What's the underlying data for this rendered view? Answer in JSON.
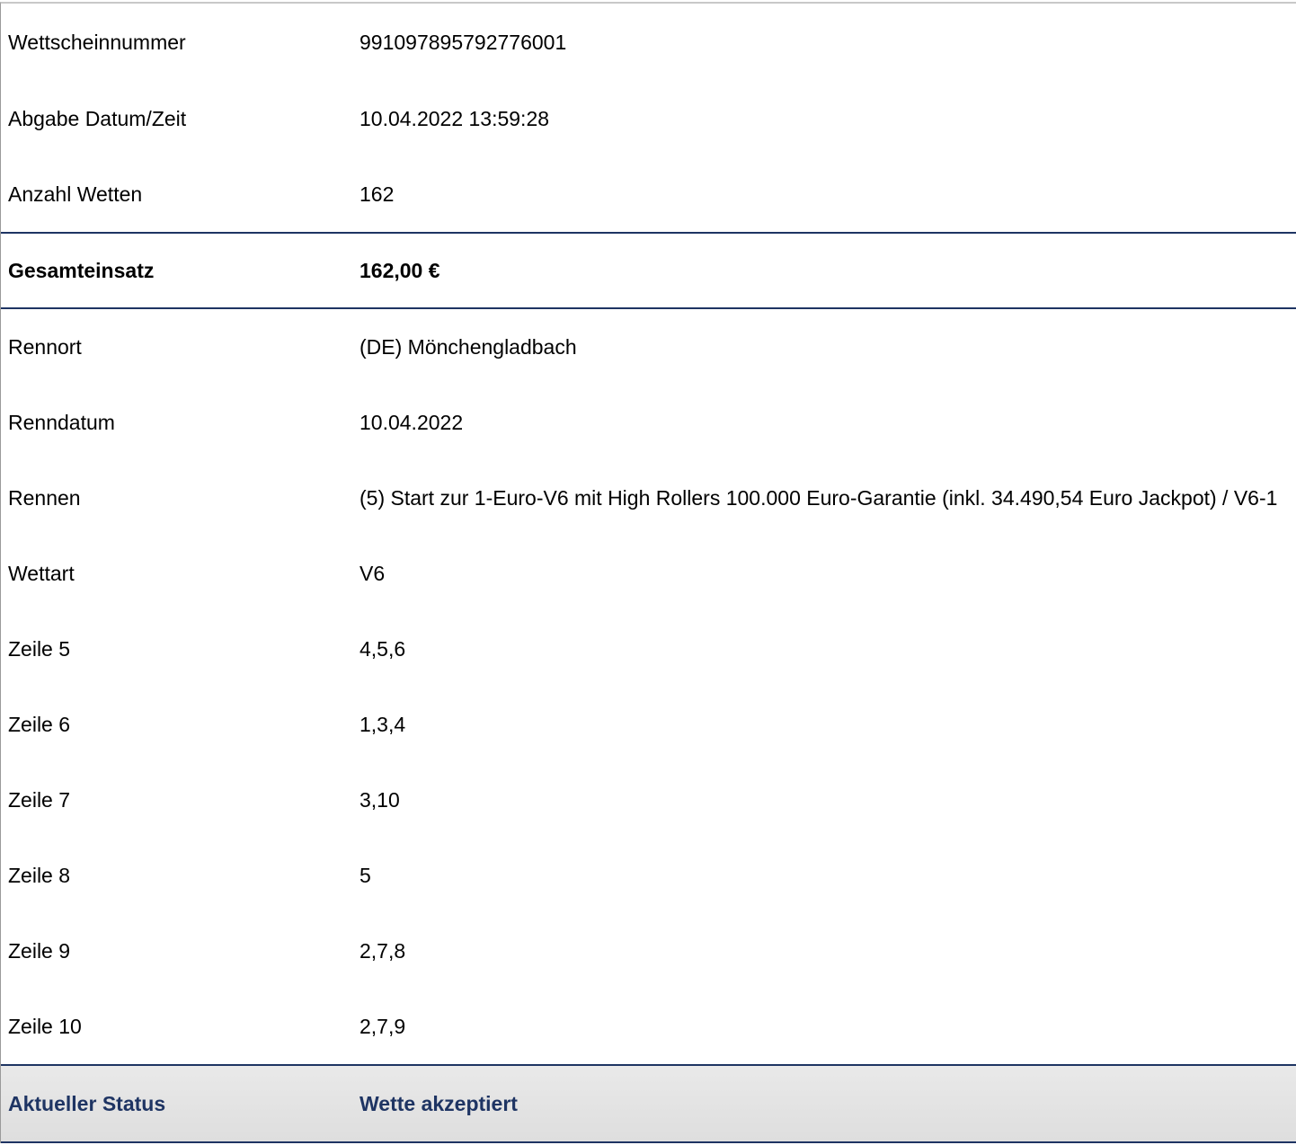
{
  "ticket": {
    "number": {
      "label": "Wettscheinnummer",
      "value": "991097895792776001"
    },
    "submitted": {
      "label": "Abgabe Datum/Zeit",
      "value": "10.04.2022 13:59:28"
    },
    "bet_count": {
      "label": "Anzahl Wetten",
      "value": "162"
    },
    "total_stake": {
      "label": "Gesamteinsatz",
      "value": "162,00 €"
    },
    "race_venue": {
      "label": "Rennort",
      "value": "(DE) Mönchengladbach"
    },
    "race_date": {
      "label": "Renndatum",
      "value": "10.04.2022"
    },
    "race": {
      "label": "Rennen",
      "value": "(5) Start zur 1-Euro-V6 mit High Rollers 100.000 Euro-Garantie (inkl. 34.490,54 Euro Jackpot) / V6-1"
    },
    "bet_type": {
      "label": "Wettart",
      "value": "V6"
    },
    "lines": [
      {
        "label": "Zeile 5",
        "value": "4,5,6"
      },
      {
        "label": "Zeile 6",
        "value": "1,3,4"
      },
      {
        "label": "Zeile 7",
        "value": "3,10"
      },
      {
        "label": "Zeile 8",
        "value": "5"
      },
      {
        "label": "Zeile 9",
        "value": "2,7,8"
      },
      {
        "label": "Zeile 10",
        "value": "2,7,9"
      }
    ],
    "status": {
      "label": "Aktueller Status",
      "value": "Wette akzeptiert"
    }
  },
  "colors": {
    "accent": "#1e3463",
    "status_background": "#e4e4e4"
  }
}
